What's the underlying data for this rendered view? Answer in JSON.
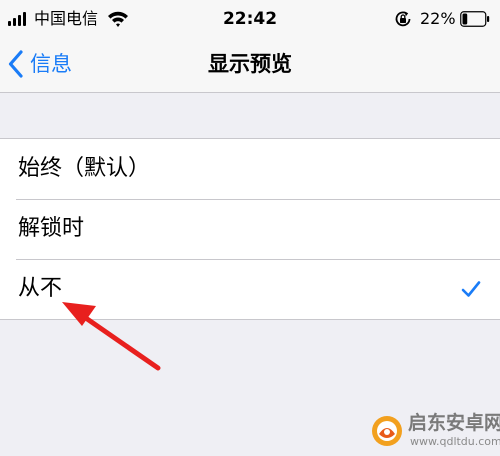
{
  "status_bar": {
    "carrier": "中国电信",
    "time": "22:42",
    "battery_percent": "22%",
    "battery_level": 0.22,
    "icons": {
      "signal": "cellular-signal-icon",
      "wifi": "wifi-icon",
      "rotation_lock": "rotation-lock-icon",
      "battery": "battery-icon"
    }
  },
  "nav": {
    "back_label": "信息",
    "back_icon": "chevron-left-icon",
    "title": "显示预览"
  },
  "options": [
    {
      "label": "始终（默认）",
      "selected": false
    },
    {
      "label": "解锁时",
      "selected": false
    },
    {
      "label": "从不",
      "selected": true
    }
  ],
  "watermark": {
    "title": "启东安卓网",
    "url": "www.qdltdu.com"
  },
  "colors": {
    "accent": "#1a7cf7",
    "background": "#efeff4",
    "annotation": "#e8201e"
  }
}
